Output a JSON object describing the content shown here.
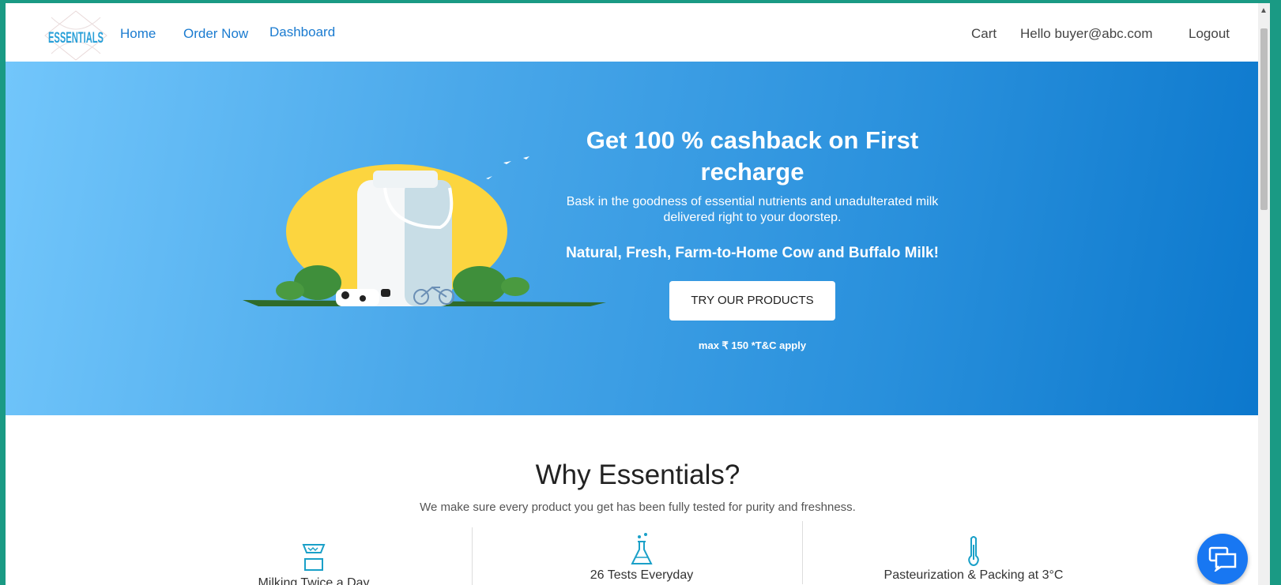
{
  "nav": {
    "logo_text": "ESSENTIALS",
    "links": [
      "Home",
      "Order Now",
      "Dashboard"
    ],
    "cart": "Cart",
    "greeting": "Hello buyer@abc.com",
    "logout": "Logout"
  },
  "hero": {
    "title": "Get 100 % cashback on First recharge",
    "subtitle": "Bask in the goodness of essential nutrients and unadulterated milk delivered right to your doorstep.",
    "tagline": "Natural, Fresh, Farm-to-Home Cow and Buffalo Milk!",
    "cta": "TRY OUR PRODUCTS",
    "fine_print": "max ₹ 150 *T&C apply"
  },
  "why": {
    "title": "Why Essentials?",
    "subtitle": "We make sure every product you get has been fully tested for purity and freshness.",
    "features": [
      {
        "label": "Milking Twice a Day",
        "icon": "udder-icon"
      },
      {
        "label": "26 Tests Everyday",
        "icon": "flask-icon"
      },
      {
        "label": "Pasteurization & Packing at 3°C",
        "icon": "thermometer-icon"
      }
    ]
  },
  "colors": {
    "accent": "#1a7bd0",
    "hero_start": "#72c6fb",
    "hero_end": "#0b77cc",
    "chat": "#1877f2",
    "frame": "#1a9a84"
  }
}
